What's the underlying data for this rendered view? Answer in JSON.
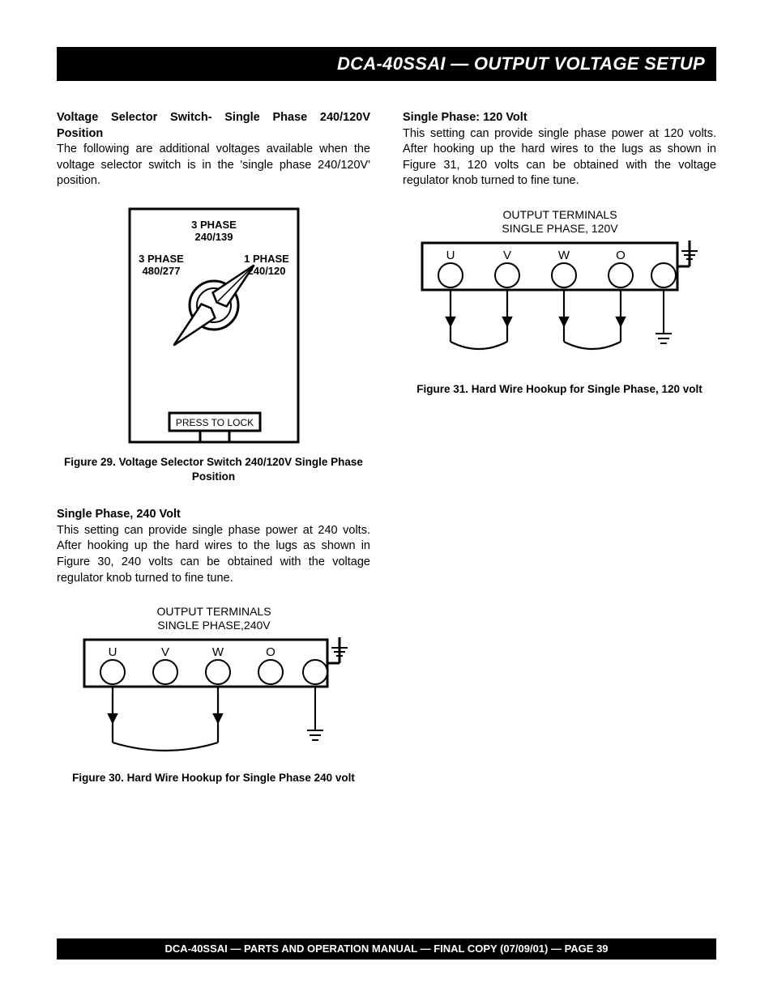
{
  "header_title": "DCA-40SSAI — OUTPUT VOLTAGE SETUP",
  "left": {
    "sec1_title": "Voltage Selector Switch- Single Phase  240/120V Position",
    "sec1_body": "The following are additional voltages available when the voltage selector switch is in the 'single phase 240/120V' position.",
    "fig29_caption": "Figure 29.  Voltage Selector Switch 240/120V Single Phase Position",
    "sec2_title": "Single Phase, 240 Volt",
    "sec2_body": "This setting can provide single phase power at 240 volts. After hooking up the hard wires to the lugs as shown in Figure 30, 240 volts can be obtained with the voltage regulator knob turned to fine tune.",
    "fig30_caption": "Figure 30.  Hard Wire Hookup for Single Phase 240 volt"
  },
  "right": {
    "sec1_title": "Single Phase: 120 Volt",
    "sec1_body": "This setting can provide single phase power at 120 volts. After hooking up the hard wires to the lugs as shown in Figure 31, 120 volts can be obtained with the voltage regulator knob turned to fine tune.",
    "fig31_caption": "Figure 31.  Hard Wire Hookup for Single Phase, 120 volt"
  },
  "fig29": {
    "top_line1": "3 PHASE",
    "top_line2": "240/139",
    "left_line1": "3 PHASE",
    "left_line2": "480/277",
    "right_line1": "1 PHASE",
    "right_line2": "240/120",
    "button": "PRESS TO LOCK"
  },
  "fig30": {
    "title_l1": "OUTPUT TERMINALS",
    "title_l2": "SINGLE PHASE,240V",
    "labels": {
      "u": "U",
      "v": "V",
      "w": "W",
      "o": "O"
    }
  },
  "fig31": {
    "title_l1": "OUTPUT TERMINALS",
    "title_l2": "SINGLE PHASE, 120V",
    "labels": {
      "u": "U",
      "v": "V",
      "w": "W",
      "o": "O"
    }
  },
  "footer": "DCA-40SSAI — PARTS AND OPERATION  MANUAL — FINAL COPY  (07/09/01) — PAGE 39"
}
